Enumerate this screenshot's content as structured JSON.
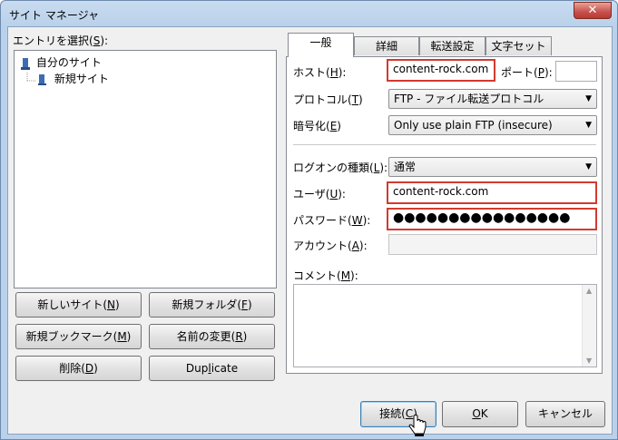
{
  "window": {
    "title": "サイト マネージャ",
    "close_glyph": "✕"
  },
  "left": {
    "entries_label_pre": "エントリを選択(",
    "entries_label_key": "S",
    "entries_label_post": "):",
    "tree": [
      {
        "label": "自分のサイト",
        "level": 0
      },
      {
        "label": "新規サイト",
        "level": 1
      }
    ],
    "buttons": {
      "new_site": {
        "pre": "新しいサイト(",
        "key": "N",
        "post": ")"
      },
      "new_folder": {
        "pre": "新規フォルダ(",
        "key": "F",
        "post": ")"
      },
      "new_bookmark": {
        "pre": "新規ブックマーク(",
        "key": "M",
        "post": ")"
      },
      "rename": {
        "pre": "名前の変更(",
        "key": "R",
        "post": ")"
      },
      "delete": {
        "pre": "削除(",
        "key": "D",
        "post": ")"
      },
      "duplicate": {
        "pre": "Dup",
        "key": "l",
        "post": "icate"
      }
    }
  },
  "tabs": [
    {
      "label": "一般",
      "active": true
    },
    {
      "label": "詳細",
      "active": false
    },
    {
      "label": "転送設定",
      "active": false
    },
    {
      "label": "文字セット",
      "active": false
    }
  ],
  "general": {
    "host_label": {
      "pre": "ホスト(",
      "key": "H",
      "post": "):"
    },
    "host_value": "content-rock.com",
    "port_label": {
      "pre": "ポート(",
      "key": "P",
      "post": "):"
    },
    "port_value": "",
    "protocol_label": {
      "pre": "プロトコル(",
      "key": "T",
      "post": ")"
    },
    "protocol_value": "FTP - ファイル転送プロトコル",
    "encryption_label": {
      "pre": "暗号化(",
      "key": "E",
      "post": ")"
    },
    "encryption_value": "Only use plain FTP (insecure)",
    "logon_label": {
      "pre": "ログオンの種類(",
      "key": "L",
      "post": "):"
    },
    "logon_value": "通常",
    "user_label": {
      "pre": "ユーザ(",
      "key": "U",
      "post": "):"
    },
    "user_value": "content-rock.com",
    "password_label": {
      "pre": "パスワード(",
      "key": "W",
      "post": "):"
    },
    "password_value": "●●●●●●●●●●●●●●●●",
    "account_label": {
      "pre": "アカウント(",
      "key": "A",
      "post": "):"
    },
    "account_value": "",
    "comment_label": {
      "pre": "コメント(",
      "key": "M",
      "post": "):"
    },
    "comment_value": ""
  },
  "bottom": {
    "connect": {
      "pre": "接続(",
      "key": "C",
      "post": ")"
    },
    "ok": {
      "pre": "",
      "key": "O",
      "post": "K"
    },
    "cancel": "キャンセル"
  },
  "colors": {
    "highlight_border": "#d33a2f"
  }
}
